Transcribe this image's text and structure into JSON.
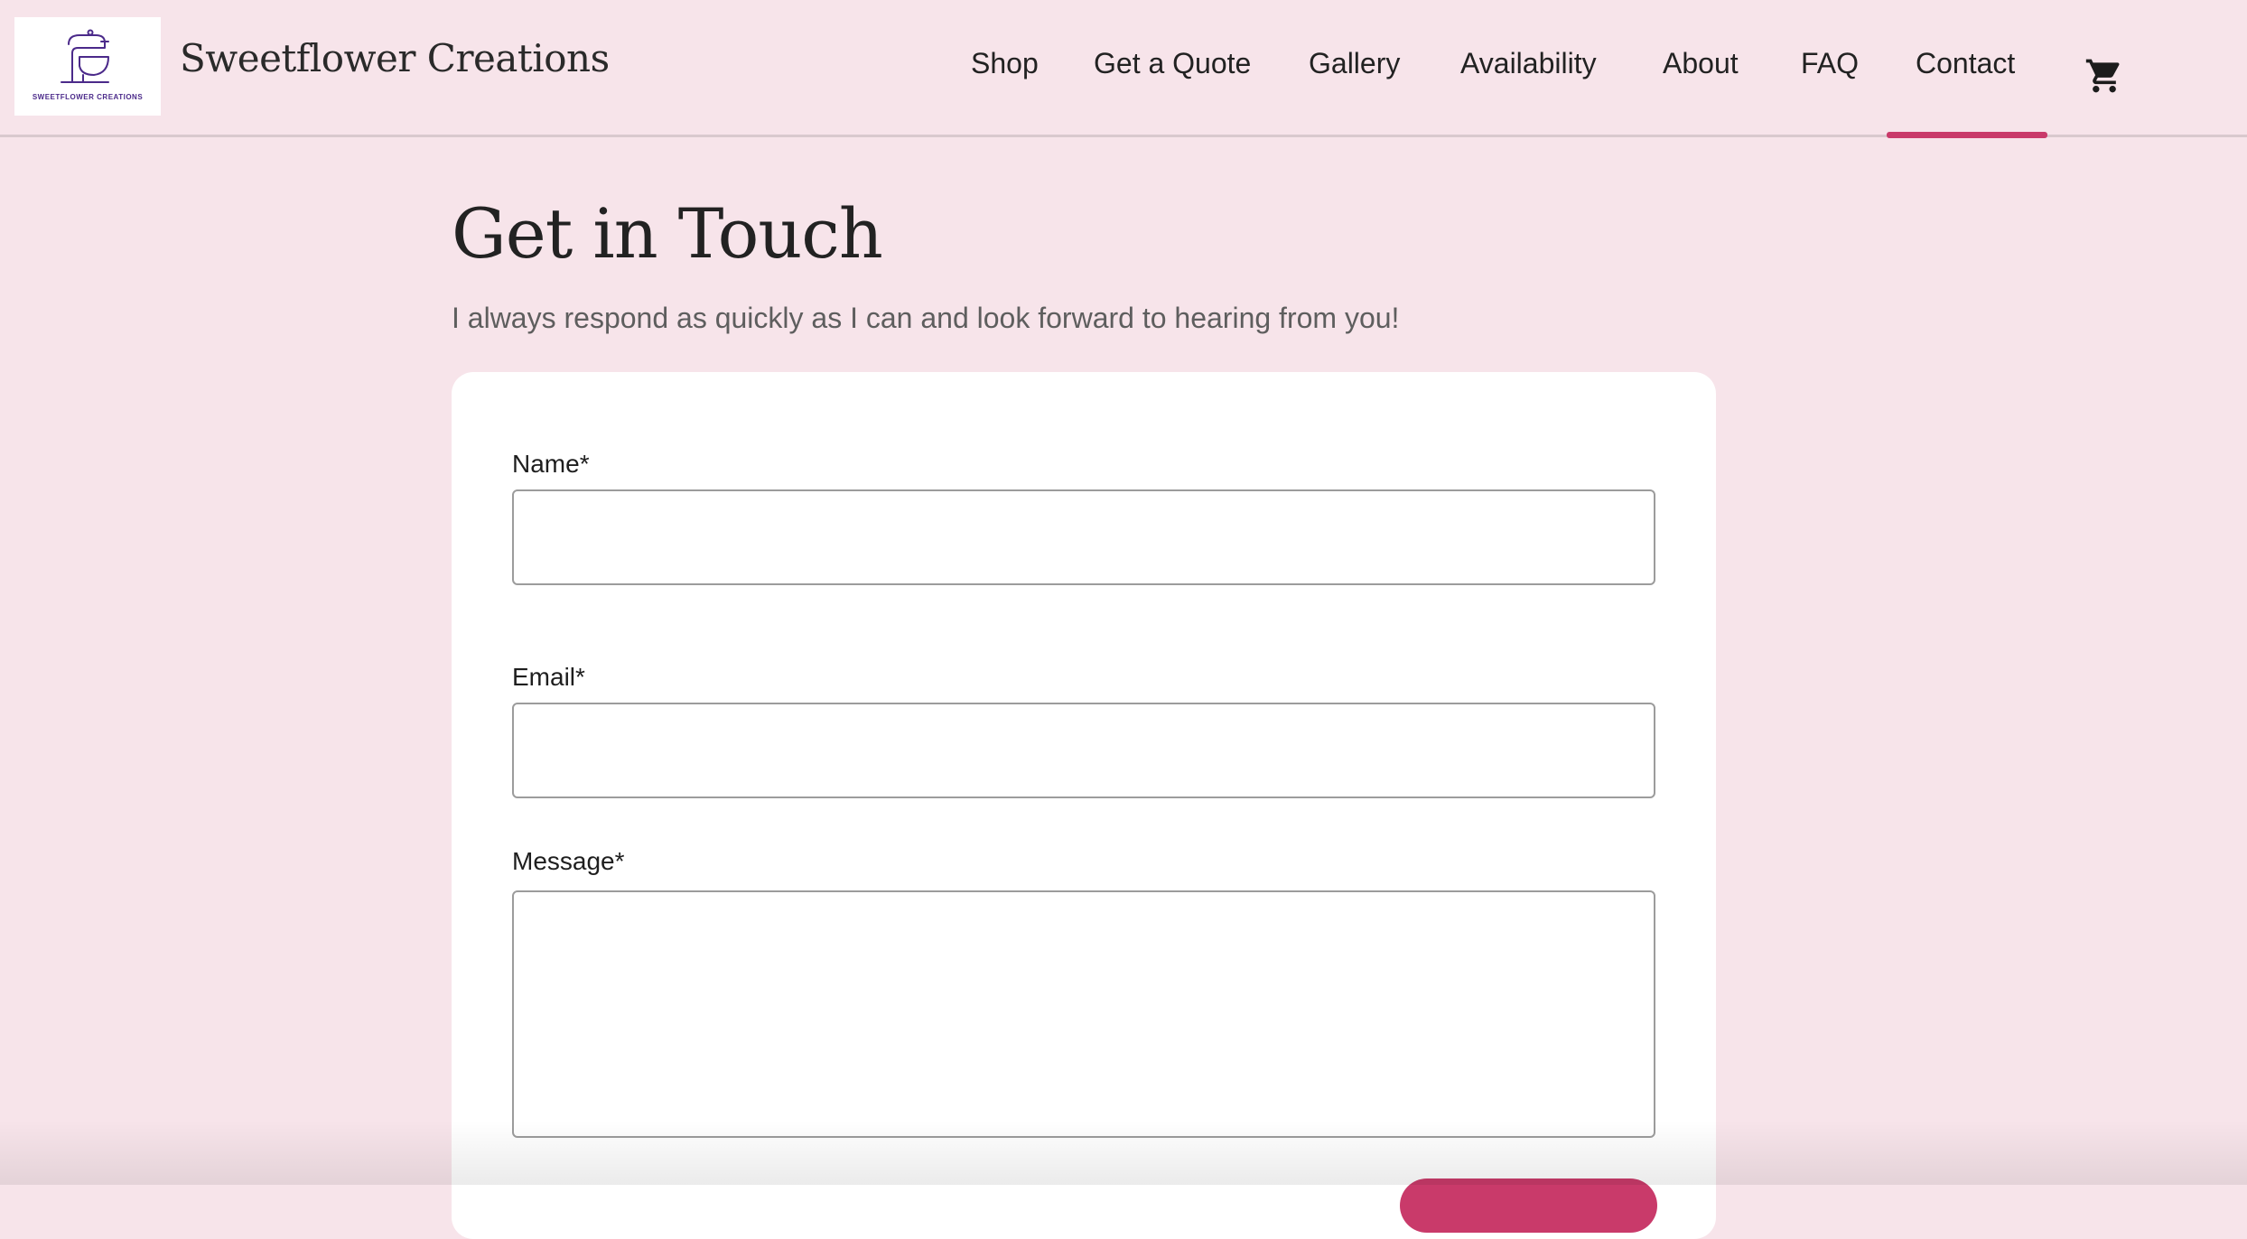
{
  "site": {
    "brand_name": "Sweetflower Creations",
    "logo_text": "SWEETFLOWER CREATIONS",
    "logo_icon": "stand-mixer-icon"
  },
  "nav": {
    "items": [
      {
        "label": "Shop"
      },
      {
        "label": "Get a Quote"
      },
      {
        "label": "Gallery"
      },
      {
        "label": "Availability"
      },
      {
        "label": "About"
      },
      {
        "label": "FAQ"
      },
      {
        "label": "Contact",
        "active": true
      }
    ],
    "cart_icon": "shopping-cart-icon"
  },
  "page": {
    "title": "Get in Touch",
    "subtitle": "I always respond as quickly as I can and look forward to hearing from you!"
  },
  "form": {
    "name_label": "Name*",
    "name_value": "",
    "email_label": "Email*",
    "email_value": "",
    "message_label": "Message*",
    "message_value": ""
  },
  "colors": {
    "background": "#f7e4ea",
    "accent": "#c93a6a",
    "card": "#ffffff",
    "logo_purple": "#4b2a8a"
  }
}
